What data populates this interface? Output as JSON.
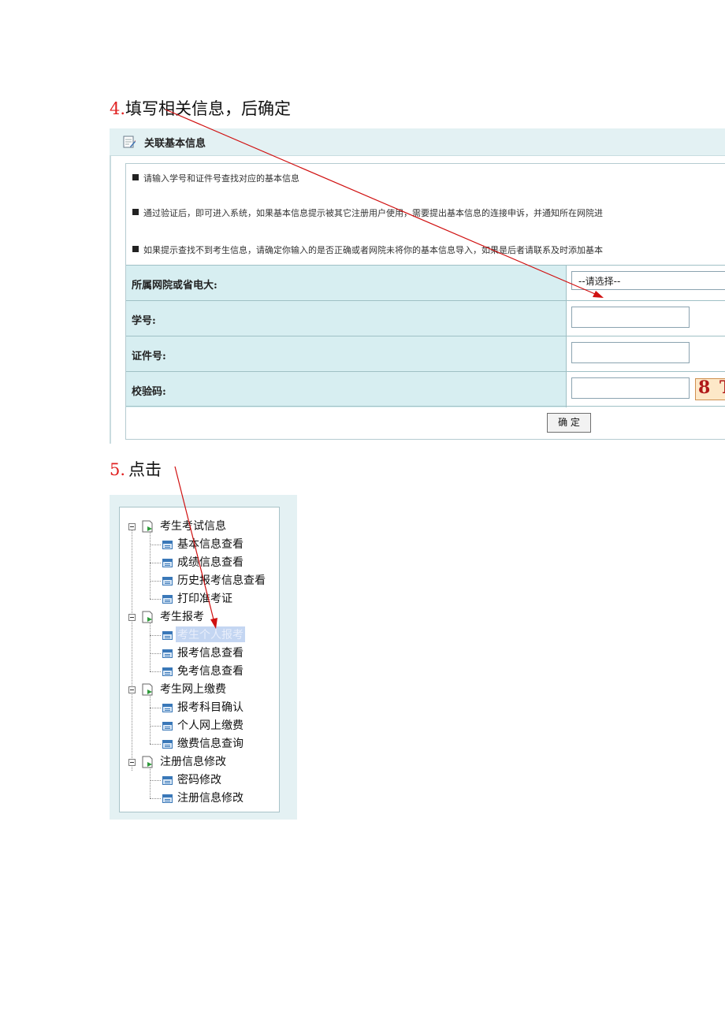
{
  "step4": {
    "num": "4.",
    "text": "填写相关信息，后确定"
  },
  "step5": {
    "num": "5.",
    "text": "点击"
  },
  "panel": {
    "title": "关联基本信息",
    "tips": [
      "请输入学号和证件号查找对应的基本信息",
      "通过验证后，即可进入系统，如果基本信息提示被其它注册用户使用，需要提出基本信息的连接申诉，并通知所在网院进",
      "如果提示查找不到考生信息，请确定你输入的是否正确或者网院未将你的基本信息导入，如果是后者请联系及时添加基本"
    ],
    "fields": {
      "school_label": "所属网院或省电大:",
      "school_value": "--请选择--",
      "student_id_label": "学号:",
      "cert_label": "证件号:",
      "captcha_label": "校验码:",
      "captcha_text": "8 T"
    },
    "submit_label": "确 定"
  },
  "tree": [
    {
      "label": "考生考试信息",
      "children": [
        "基本信息查看",
        "成绩信息查看",
        "历史报考信息查看",
        "打印准考证"
      ]
    },
    {
      "label": "考生报考",
      "children": [
        "考生个人报考",
        "报考信息查看",
        "免考信息查看"
      ]
    },
    {
      "label": "考生网上缴费",
      "children": [
        "报考科目确认",
        "个人网上缴费",
        "缴费信息查询"
      ]
    },
    {
      "label": "注册信息修改",
      "children": [
        "密码修改",
        "注册信息修改"
      ]
    }
  ],
  "selected_item": "考生个人报考",
  "colors": {
    "accent_red": "#e02020",
    "arrow": "#d01010",
    "header_bg": "#e3f1f3",
    "label_bg": "#d7eef1"
  }
}
